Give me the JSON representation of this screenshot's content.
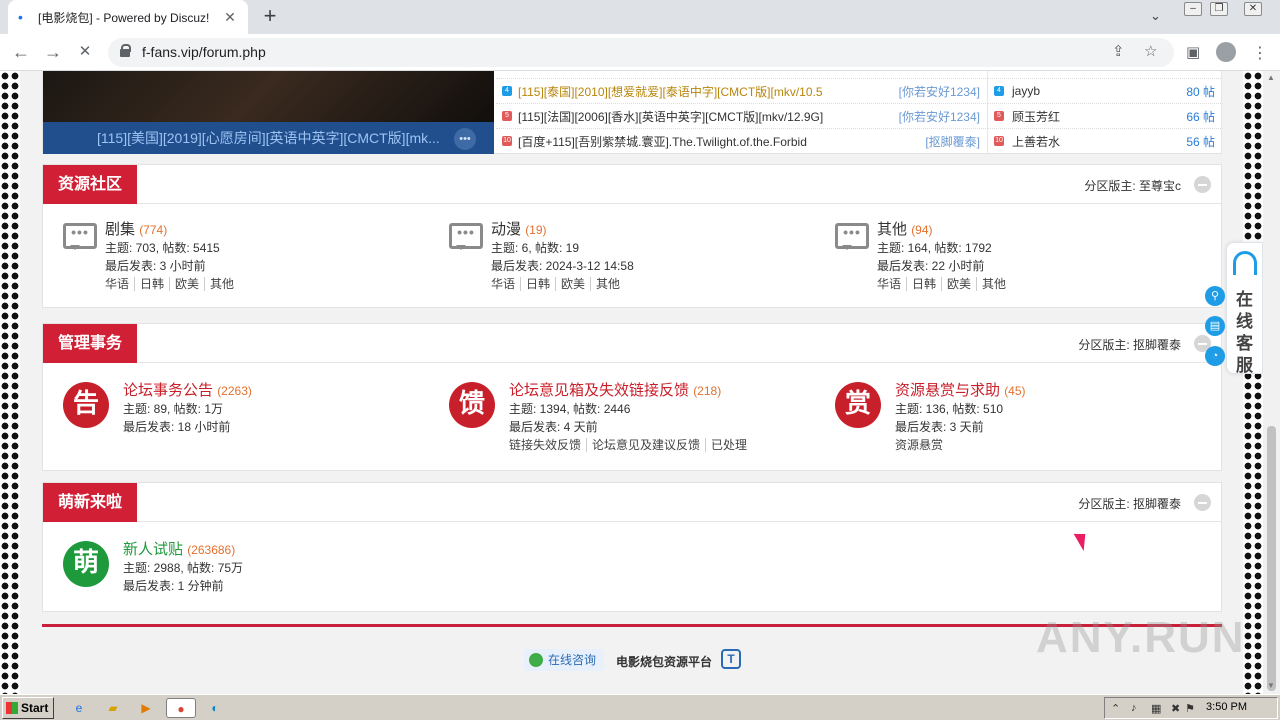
{
  "browser": {
    "tab_title": "[电影烧包] - Powered by Discuz!",
    "tab_close": "✕",
    "new_tab": "+",
    "url": "f-fans.vip/forum.php",
    "back": "←",
    "forward": "→",
    "reload": "✕",
    "menu": "⋮",
    "tab_list": "⌄"
  },
  "hot": {
    "caption": "[115][美国][2019][心愿房间][英语中英字][CMCT版][mk...",
    "threads": [
      {
        "title": "[115][泰国][2010][想爱就爱][泰语中字][CMCT版][mkv/10.5",
        "author": "[你若安好1234]",
        "num": "4",
        "title_color": "#b8860b"
      },
      {
        "title": "[115][法国][2006][香水][英语中英字][CMCT版][mkv/12.9G]",
        "author": "[你若安好1234]",
        "num": "5",
        "title_color": "#333"
      },
      {
        "title": "[百度+115][吾别紫禁城.寰亚].The.Twilight.of.the.Forbid",
        "author": "[抠脚覆泰]",
        "num": "10",
        "title_color": "#333"
      }
    ],
    "users": [
      {
        "name": "jayyb",
        "count": "80 帖",
        "num": "4"
      },
      {
        "name": "顾玉芳红",
        "count": "66 帖",
        "num": "5"
      },
      {
        "name": "上善若水",
        "count": "56 帖",
        "num": "10"
      }
    ]
  },
  "sections": [
    {
      "title": "资源社区",
      "moderator": "分区版主: 至尊宝c",
      "forums": [
        {
          "name": "剧集",
          "count": "(774)",
          "stats": "主题: 703, 帖数: 5415",
          "last": "最后发表: 3 小时前",
          "subs": [
            "华语",
            "日韩",
            "欧美",
            "其他"
          ]
        },
        {
          "name": "动漫",
          "count": "(19)",
          "stats": "主题: 6, 帖数: 19",
          "last": "最后发表: 2024-3-12 14:58",
          "subs": [
            "华语",
            "日韩",
            "欧美",
            "其他"
          ]
        },
        {
          "name": "其他",
          "count": "(94)",
          "stats": "主题: 164, 帖数: 1792",
          "last": "最后发表: 22 小时前",
          "subs": [
            "华语",
            "日韩",
            "欧美",
            "其他"
          ]
        }
      ]
    },
    {
      "title": "管理事务",
      "moderator": "分区版主: 抠脚覆泰",
      "forums": [
        {
          "icon": "告",
          "name": "论坛事务公告",
          "count": "(2263)",
          "stats": "主题: 89, 帖数: 1万",
          "last": "最后发表: 18 小时前",
          "subs": []
        },
        {
          "icon": "馈",
          "name": "论坛意见箱及失效链接反馈",
          "count": "(218)",
          "stats": "主题: 1394, 帖数: 2446",
          "last": "最后发表: 4 天前",
          "subs": [
            "链接失效反馈",
            "论坛意见及建议反馈",
            "已处理"
          ]
        },
        {
          "icon": "赏",
          "name": "资源悬赏与求助",
          "count": "(45)",
          "stats": "主题: 136, 帖数: 510",
          "last": "最后发表: 3 天前",
          "subs": [
            "资源悬赏"
          ]
        }
      ]
    },
    {
      "title": "萌新来啦",
      "moderator": "分区版主: 抠脚覆泰",
      "forums": [
        {
          "icon": "萌",
          "name": "新人试贴",
          "count": "(263686)",
          "stats": "主题: 2988, 帖数: 75万",
          "last": "最后发表: 1 分钟前",
          "subs": []
        }
      ]
    }
  ],
  "footer": {
    "consult": "在线咨询",
    "platform": "电影烧包资源平台",
    "logo": "T"
  },
  "service": {
    "text": "在线客服"
  },
  "watermark": "ANY.RUN",
  "taskbar": {
    "start": "Start",
    "clock": "3:50 PM"
  },
  "colors": {
    "accent": "#d11f35",
    "forum_red": "#c8202b",
    "forum_green": "#1e9a3c",
    "count": "#e3712e"
  }
}
